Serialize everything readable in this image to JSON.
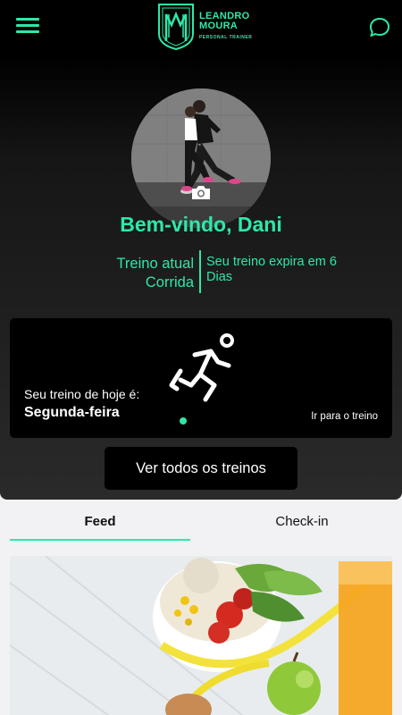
{
  "brand": {
    "name_line1": "LEANDRO",
    "name_line2": "MOURA",
    "subtitle": "PERSONAL TRAINER",
    "accent": "#2ee8a8"
  },
  "header": {
    "menu_icon": "hamburger-menu-icon",
    "chat_icon": "chat-bubble-icon"
  },
  "profile": {
    "photo_alt": "Profile photo",
    "camera_icon": "camera-icon",
    "welcome": "Bem-vindo, Dani"
  },
  "current_workout": {
    "label": "Treino atual",
    "value": "Corrida",
    "expiry_text": "Seu treino expira em 6 Dias"
  },
  "today_card": {
    "icon": "running-person-icon",
    "label": "Seu treino de hoje é:",
    "day": "Segunda-feira",
    "link": "Ir para o treino"
  },
  "all_workouts_button": "Ver todos os treinos",
  "tabs": [
    {
      "label": "Feed",
      "active": true
    },
    {
      "label": "Check-in",
      "active": false
    }
  ],
  "feed": {
    "first_post_image": "healthy food with measuring tape"
  }
}
